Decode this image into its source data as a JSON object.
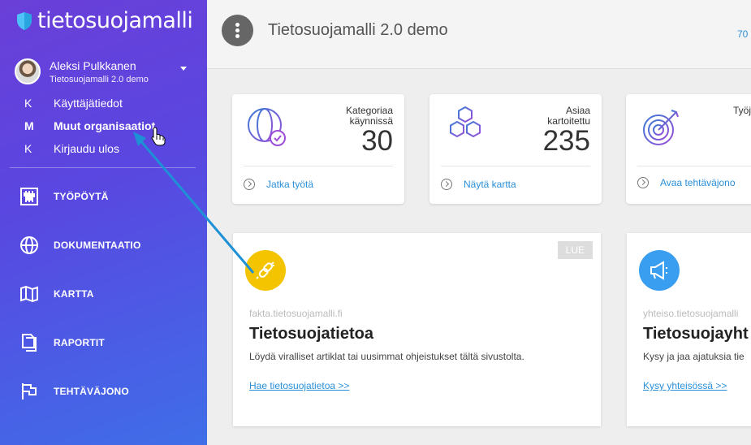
{
  "brand": {
    "name": "tietosuojamalli"
  },
  "user": {
    "name": "Aleksi Pulkkanen",
    "org": "Tietosuojamalli 2.0 demo"
  },
  "user_menu": [
    {
      "key": "K",
      "label": "Käyttäjätiedot"
    },
    {
      "key": "M",
      "label": "Muut organisaatiot"
    },
    {
      "key": "K",
      "label": "Kirjaudu ulos"
    }
  ],
  "nav": [
    {
      "label": "TYÖPÖYTÄ",
      "icon": "sliders-icon"
    },
    {
      "label": "DOKUMENTAATIO",
      "icon": "globe-icon"
    },
    {
      "label": "KARTTA",
      "icon": "map-icon"
    },
    {
      "label": "RAPORTIT",
      "icon": "reports-icon"
    },
    {
      "label": "TEHTÄVÄJONO",
      "icon": "flag-icon"
    }
  ],
  "header": {
    "title": "Tietosuojamalli 2.0 demo",
    "count": "70"
  },
  "stats": [
    {
      "label_line1": "Kategoriaa",
      "label_line2": "käynnissä",
      "value": "30",
      "link": "Jatka työtä"
    },
    {
      "label_line1": "Asiaa",
      "label_line2": "kartoitettu",
      "value": "235",
      "link": "Näytä kartta"
    },
    {
      "label_line1": "Työj",
      "label_line2": "",
      "value": "",
      "link": "Avaa tehtäväjono"
    }
  ],
  "cards": [
    {
      "badge": "LUE",
      "site": "fakta.tietosuojamalli.fi",
      "title": "Tietosuojatietoa",
      "desc": "Löydä viralliset artiklat tai uusimmat ohjeistukset tältä sivustolta.",
      "link": "Hae tietosuojatietoa >>",
      "color": "#f5c400"
    },
    {
      "badge": "",
      "site": "yhteiso.tietosuojamalli",
      "title": "Tietosuojayht",
      "desc": "Kysy ja jaa ajatuksia tie",
      "link": "Kysy yhteisössä >>",
      "color": "#3a9ef0"
    }
  ]
}
